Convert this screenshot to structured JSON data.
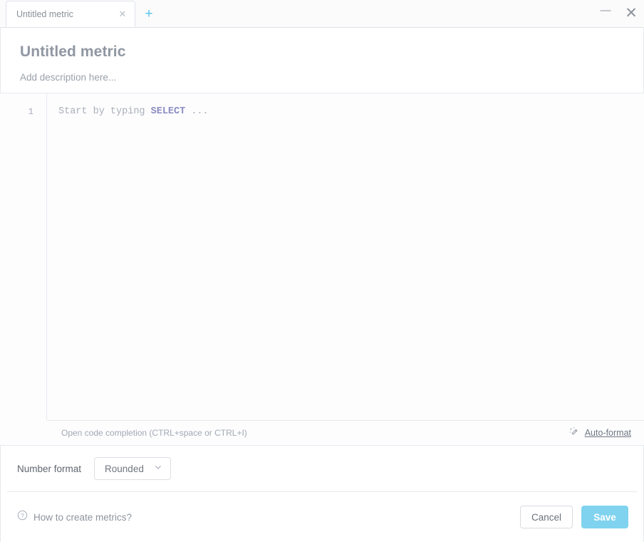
{
  "window": {
    "minimize_label": "—",
    "close_label": "✕"
  },
  "tabs": {
    "items": [
      {
        "label": "Untitled metric",
        "close_label": "✕"
      }
    ],
    "add_label": "+"
  },
  "header": {
    "title": "Untitled metric",
    "description_placeholder": "Add description here..."
  },
  "editor": {
    "line_numbers": [
      "1"
    ],
    "placeholder_prefix": "Start by typing ",
    "placeholder_keyword": "SELECT",
    "placeholder_suffix": " ...",
    "status_hint": "Open code completion (CTRL+space or CTRL+I)",
    "autoformat_label": "Auto-format",
    "autoformat_icon": "magic-wand-icon"
  },
  "number_format": {
    "label": "Number format",
    "selected": "Rounded",
    "options": [
      "Rounded"
    ],
    "chevron_icon": "chevron-down-icon"
  },
  "footer": {
    "help_label": "How to create metrics?",
    "help_icon": "question-circle-icon",
    "cancel_label": "Cancel",
    "save_label": "Save"
  },
  "colors": {
    "accent": "#56c3e8",
    "save_button": "#7fd3ef",
    "keyword": "#8a8cc2",
    "title_text": "#9096a2"
  }
}
